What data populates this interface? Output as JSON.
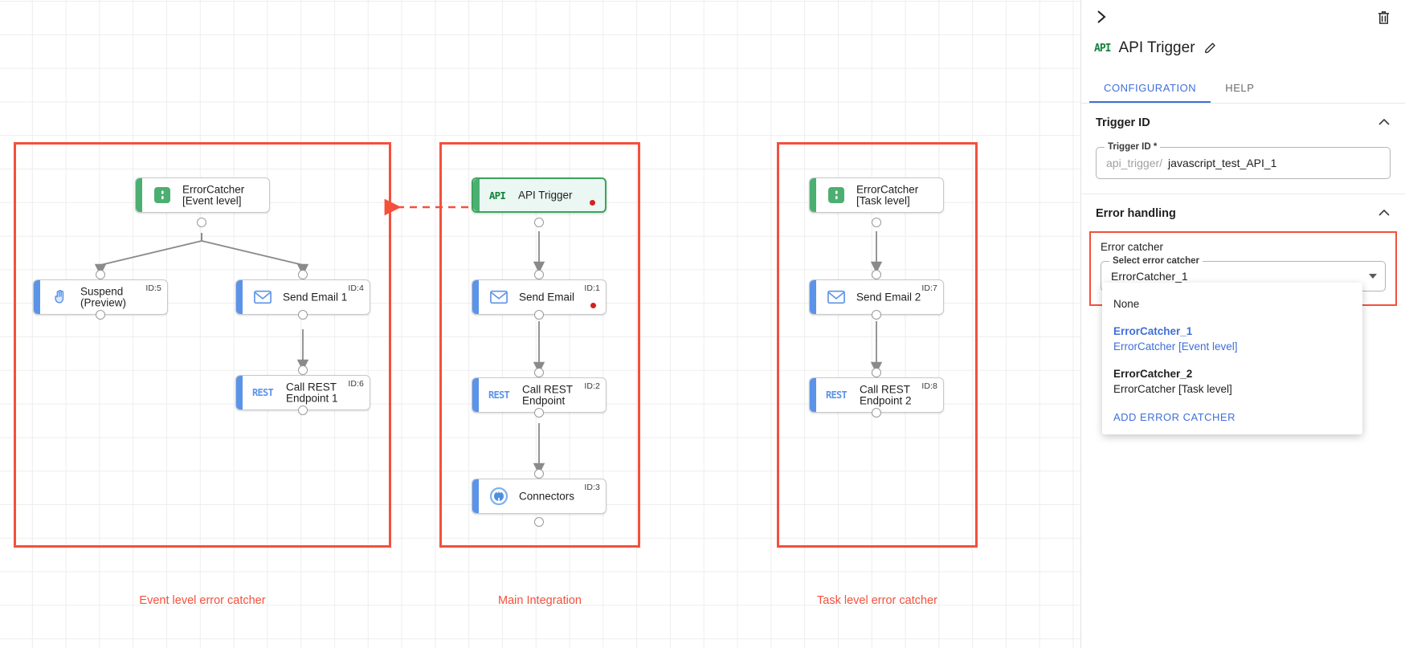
{
  "canvas": {
    "groups": [
      {
        "id": "g1",
        "label": "Event level error catcher"
      },
      {
        "id": "g2",
        "label": "Main Integration"
      },
      {
        "id": "g3",
        "label": "Task level error catcher"
      }
    ],
    "nodes": [
      {
        "id": "n-ec1",
        "label": "ErrorCatcher\n[Event level]",
        "icon": "error-catcher-icon",
        "accent": "green",
        "id_label": "",
        "selected": false,
        "dot": false
      },
      {
        "id": "n-susp",
        "label": "Suspend\n(Preview)",
        "icon": "hand-icon",
        "accent": "blue",
        "id_label": "ID:5",
        "selected": false,
        "dot": false
      },
      {
        "id": "n-em1",
        "label": "Send Email 1",
        "icon": "envelope-icon",
        "accent": "blue",
        "id_label": "ID:4",
        "selected": false,
        "dot": false
      },
      {
        "id": "n-rest1",
        "label": "Call REST\nEndpoint 1",
        "icon": "rest-icon",
        "accent": "blue",
        "id_label": "ID:6",
        "selected": false,
        "dot": false
      },
      {
        "id": "n-api",
        "label": "API Trigger",
        "icon": "api-icon",
        "accent": "green",
        "id_label": "",
        "selected": true,
        "dot": true
      },
      {
        "id": "n-em0",
        "label": "Send Email",
        "icon": "envelope-icon",
        "accent": "blue",
        "id_label": "ID:1",
        "selected": false,
        "dot": true
      },
      {
        "id": "n-rest0",
        "label": "Call REST\nEndpoint",
        "icon": "rest-icon",
        "accent": "blue",
        "id_label": "ID:2",
        "selected": false,
        "dot": false
      },
      {
        "id": "n-conn",
        "label": "Connectors",
        "icon": "connectors-icon",
        "accent": "blue",
        "id_label": "ID:3",
        "selected": false,
        "dot": false
      },
      {
        "id": "n-ec2",
        "label": "ErrorCatcher\n[Task level]",
        "icon": "error-catcher-icon",
        "accent": "green",
        "id_label": "",
        "selected": false,
        "dot": false
      },
      {
        "id": "n-em2",
        "label": "Send Email 2",
        "icon": "envelope-icon",
        "accent": "blue",
        "id_label": "ID:7",
        "selected": false,
        "dot": false
      },
      {
        "id": "n-rest2",
        "label": "Call REST\nEndpoint 2",
        "icon": "rest-icon",
        "accent": "blue",
        "id_label": "ID:8",
        "selected": false,
        "dot": false
      }
    ],
    "colors": {
      "group_border": "#f4503c",
      "node_accent_blue": "#5b93e8",
      "node_accent_green": "#4caf72",
      "selected_border": "#3ca55c",
      "status_dot": "#d32020",
      "edge": "#8a8a8a"
    }
  },
  "panel": {
    "collapse_icon": "chevron-right-icon",
    "delete_icon": "trash-icon",
    "badge": "API",
    "title": "API Trigger",
    "edit_icon": "pencil-icon",
    "tabs": [
      {
        "label": "CONFIGURATION",
        "active": true
      },
      {
        "label": "HELP",
        "active": false
      }
    ],
    "trigger_section": {
      "heading": "Trigger ID",
      "field_legend": "Trigger ID *",
      "prefix": "api_trigger/",
      "value": "javascript_test_API_1"
    },
    "error_section": {
      "heading": "Error handling",
      "error_catcher_label": "Error catcher",
      "select_legend": "Select error catcher",
      "selected_value": "ErrorCatcher_1",
      "options": [
        {
          "title": "None",
          "subtitle": "",
          "selected": false
        },
        {
          "title": "ErrorCatcher_1",
          "subtitle": "ErrorCatcher [Event level]",
          "selected": true
        },
        {
          "title": "ErrorCatcher_2",
          "subtitle": "ErrorCatcher [Task level]",
          "selected": false
        }
      ],
      "add_action": "ADD ERROR CATCHER"
    },
    "accent_color": "#3f6fd8",
    "highlight_color": "#f4503c"
  }
}
